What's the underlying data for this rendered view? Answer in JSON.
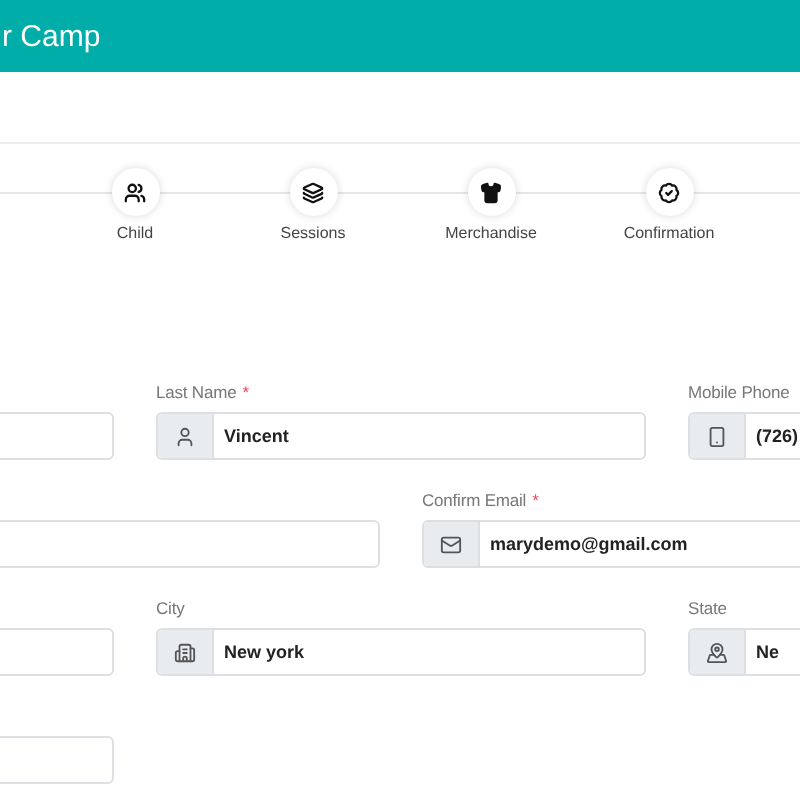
{
  "header": {
    "title": "r Camp"
  },
  "steps": [
    {
      "label": "Child"
    },
    {
      "label": "Sessions"
    },
    {
      "label": "Merchandise"
    },
    {
      "label": "Confirmation"
    }
  ],
  "form_rows": [
    {
      "fields": [
        {
          "kind": "plain"
        },
        {
          "kind": "addon",
          "label": "Last Name",
          "mark": "*",
          "value": "Vincent"
        },
        {
          "kind": "addon",
          "label": "Mobile Phone",
          "value": "(726)"
        }
      ]
    },
    {
      "fields": [
        {
          "kind": "plain"
        },
        {
          "kind": "addon",
          "label": "Confirm Email",
          "mark": "*",
          "value": "marydemo@gmail.com"
        }
      ]
    },
    {
      "fields": [
        {
          "kind": "plain"
        },
        {
          "kind": "addon",
          "label": "City",
          "value": "New york"
        },
        {
          "kind": "addon",
          "label": "State",
          "value": "Ne"
        }
      ]
    },
    {
      "fields": [
        {
          "kind": "plain"
        }
      ]
    }
  ]
}
